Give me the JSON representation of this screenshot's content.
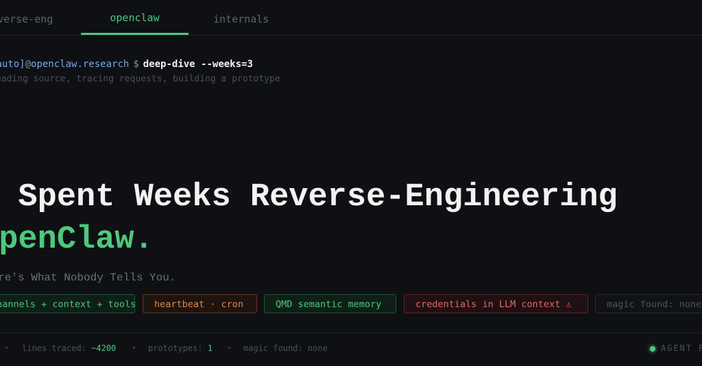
{
  "tabs": [
    {
      "label": "reverse-eng",
      "active": false
    },
    {
      "label": "openclaw",
      "active": true
    },
    {
      "label": "internals",
      "active": false
    }
  ],
  "prompt": {
    "user": "[auto]",
    "at": "@",
    "host": "openclaw.research",
    "dollar": "$",
    "command": "deep-dive --weeks=3",
    "subline": "reading source, tracing requests, building a prototype"
  },
  "headline": {
    "line1": "I Spent Weeks Reverse-Engineering",
    "line2": "OpenClaw."
  },
  "tagline": "Here's What Nobody Tells You.",
  "chips": [
    {
      "label": "channels + context + tools",
      "tone": "green"
    },
    {
      "label": "heartbeat · cron",
      "tone": "orange"
    },
    {
      "label": "QMD semantic memory",
      "tone": "green"
    },
    {
      "label": "credentials in LLM context ⚠",
      "tone": "red"
    },
    {
      "label": "magic found: none",
      "tone": "muted"
    }
  ],
  "status": {
    "lead_sep": "•",
    "lines_label": "lines traced:",
    "lines_value": "~4200",
    "prototypes_label": "prototypes:",
    "prototypes_value": "1",
    "magic_label": "magic found:",
    "magic_value": "none",
    "agent_label": "AGENT R"
  },
  "colors": {
    "background": "#0e1014",
    "accent_green": "#4ec87e",
    "accent_orange": "#e0894d",
    "accent_red": "#e06a6a",
    "prompt_blue": "#79a7e6"
  }
}
